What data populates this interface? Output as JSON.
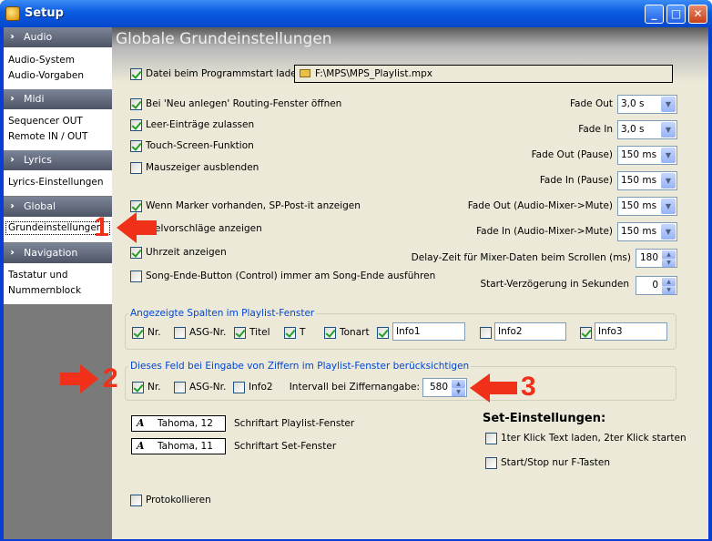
{
  "window": {
    "title": "Setup"
  },
  "sidebar": {
    "audio": {
      "title": "Audio",
      "items": [
        "Audio-System",
        "Audio-Vorgaben"
      ]
    },
    "midi": {
      "title": "Midi",
      "items": [
        "Sequencer OUT",
        "Remote IN / OUT"
      ]
    },
    "lyrics": {
      "title": "Lyrics",
      "items": [
        "Lyrics-Einstellungen"
      ]
    },
    "global": {
      "title": "Global",
      "items": [
        "Grundeinstellungen"
      ]
    },
    "navigation": {
      "title": "Navigation",
      "items": [
        "Tastatur  und",
        "Nummernblock"
      ]
    }
  },
  "main": {
    "header": "Globale Grundeinstellungen",
    "file_load_label": "Datei beim Programmstart laden:",
    "file_path": "F:\\MPS\\MPS_Playlist.mpx",
    "options": [
      {
        "label": "Bei 'Neu anlegen' Routing-Fenster öffnen",
        "checked": true
      },
      {
        "label": "Leer-Einträge zulassen",
        "checked": true
      },
      {
        "label": "Touch-Screen-Funktion",
        "checked": true
      },
      {
        "label": "Mauszeiger ausblenden",
        "checked": false
      },
      {
        "label": "Wenn Marker vorhanden, SP-Post-it anzeigen",
        "checked": true
      },
      {
        "label": "elvorschläge anzeigen",
        "checked": true
      },
      {
        "label": "Uhrzeit anzeigen",
        "checked": true
      },
      {
        "label": "Song-Ende-Button (Control)  immer am Song-Ende ausführen",
        "checked": false
      }
    ],
    "fades": [
      {
        "label": "Fade Out",
        "value": "3,0 s"
      },
      {
        "label": "Fade In",
        "value": "3,0 s"
      },
      {
        "label": "Fade Out (Pause)",
        "value": "150 ms"
      },
      {
        "label": "Fade In (Pause)",
        "value": "150 ms"
      },
      {
        "label": "Fade Out (Audio-Mixer->Mute)",
        "value": "150 ms"
      },
      {
        "label": "Fade In (Audio-Mixer->Mute)",
        "value": "150 ms"
      }
    ],
    "delay": {
      "label": "Delay-Zeit für Mixer-Daten beim Scrollen (ms)",
      "value": "180"
    },
    "start_delay": {
      "label": "Start-Verzögerung in Sekunden",
      "value": "0"
    },
    "columns_group": {
      "title": "Angezeigte Spalten im Playlist-Fenster",
      "items": [
        "Nr.",
        "ASG-Nr.",
        "Titel",
        "T",
        "Tonart"
      ],
      "info": [
        "Info1",
        "Info2",
        "Info3"
      ]
    },
    "digits_group": {
      "title": "Dieses Feld bei Eingabe von Ziffern im Playlist-Fenster berücksichtigen",
      "items": [
        "Nr.",
        "ASG-Nr.",
        "Info2"
      ],
      "interval_label": "Intervall bei Ziffernangabe:",
      "interval_value": "580"
    },
    "fonts": [
      {
        "font": "Tahoma, 12",
        "label": "Schriftart Playlist-Fenster"
      },
      {
        "font": "Tahoma, 11",
        "label": "Schriftart Set-Fenster"
      }
    ],
    "set": {
      "title": "Set-Einstellungen:",
      "items": [
        "1ter Klick Text laden, 2ter Klick starten",
        "Start/Stop nur F-Tasten"
      ]
    },
    "log_label": "Protokollieren",
    "markers": [
      "1",
      "2",
      "3"
    ]
  },
  "colors": {
    "accent": "#0a3dd6",
    "marker": "#f03018",
    "group_title": "#0046d5"
  }
}
